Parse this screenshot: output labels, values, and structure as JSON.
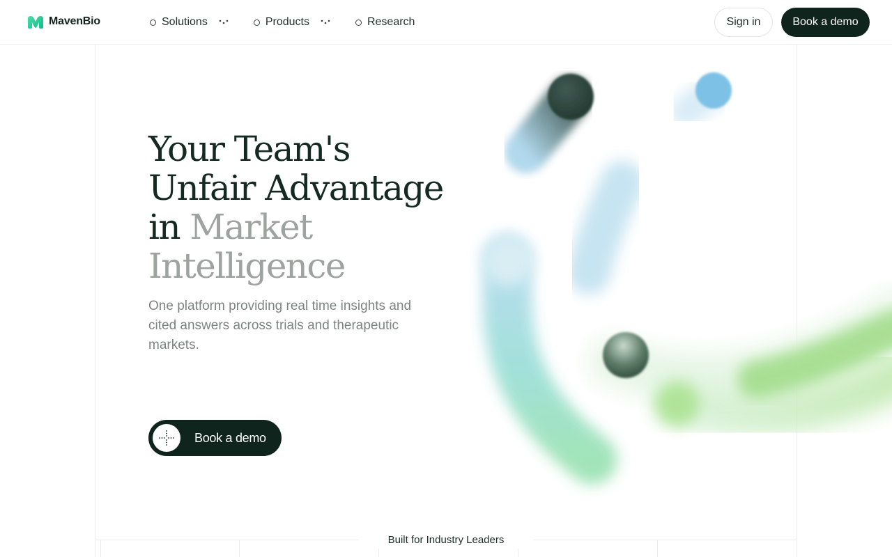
{
  "brand": {
    "name": "MavenBio",
    "accent": "#2fd39a",
    "dark": "#0f241c"
  },
  "nav": {
    "items": [
      {
        "label": "Solutions",
        "has_menu": true
      },
      {
        "label": "Products",
        "has_menu": true
      },
      {
        "label": "Research",
        "has_menu": false
      }
    ]
  },
  "header_actions": {
    "sign_in": "Sign in",
    "book_demo": "Book a demo"
  },
  "hero": {
    "title_lines": [
      "Your Team's",
      "Unfair Advantage",
      "in"
    ],
    "title_muted": [
      "Market",
      "Intelligence"
    ],
    "subtitle": "One platform providing real time insights and cited answers across trials and therapeutic markets.",
    "cta_label": "Book a demo"
  },
  "section_label": "Built for Industry Leaders"
}
